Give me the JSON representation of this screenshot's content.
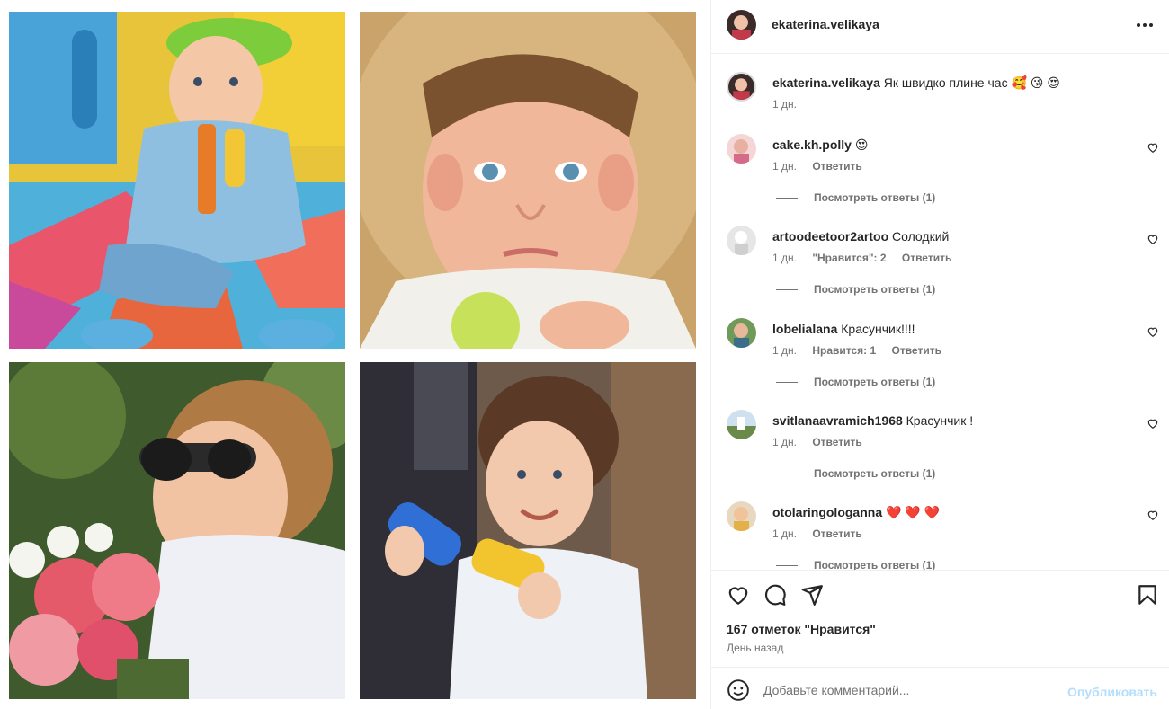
{
  "post": {
    "username": "ekaterina.velikaya",
    "more_icon": "more-horizontal-icon"
  },
  "comments": [
    {
      "user": "ekaterina.velikaya",
      "text": "Як швидко плине час 🥰 😘 😍",
      "time": "1 дн.",
      "likes_text": "",
      "reply": "",
      "view_replies": ""
    },
    {
      "user": "cake.kh.polly",
      "text": "😍",
      "time": "1 дн.",
      "likes_text": "",
      "reply": "Ответить",
      "view_replies": "Посмотреть ответы (1)"
    },
    {
      "user": "artoodeetoor2artoo",
      "text": "Солодкий",
      "time": "1 дн.",
      "likes_text": "\"Нравится\": 2",
      "reply": "Ответить",
      "view_replies": "Посмотреть ответы (1)"
    },
    {
      "user": "lobelialana",
      "text": "Красунчик!!!!",
      "time": "1 дн.",
      "likes_text": "Нравится: 1",
      "reply": "Ответить",
      "view_replies": "Посмотреть ответы (1)"
    },
    {
      "user": "svitlanaavramich1968",
      "text": "Красунчик !",
      "time": "1 дн.",
      "likes_text": "",
      "reply": "Ответить",
      "view_replies": "Посмотреть ответы (1)"
    },
    {
      "user": "otolaringologanna",
      "text": "❤️ ❤️ ❤️",
      "time": "1 дн.",
      "likes_text": "",
      "reply": "Ответить",
      "view_replies": "Посмотреть ответы (1)"
    }
  ],
  "footer": {
    "likes": "167 отметок \"Нравится\"",
    "when": "День назад",
    "comment_placeholder": "Добавьте комментарий...",
    "publish_label": "Опубликовать"
  },
  "colors": {
    "publish_disabled": "#b2dffc",
    "muted_text": "#737373",
    "divider": "#efefef"
  }
}
